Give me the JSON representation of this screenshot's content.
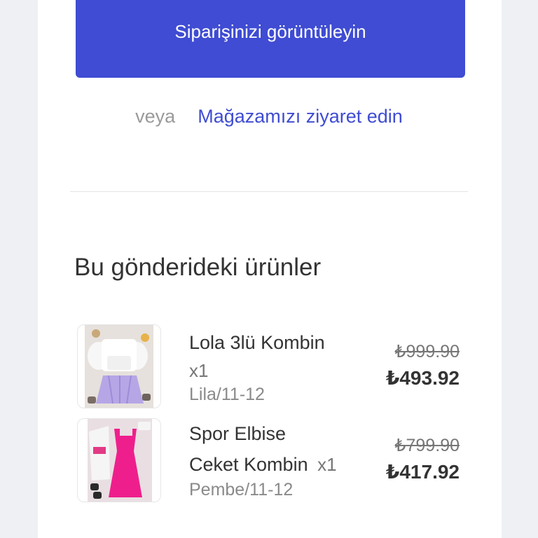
{
  "actions": {
    "view_order_label": "Siparişinizi görüntüleyin",
    "or_label": "veya",
    "visit_store_label": "Mağazamızı ziyaret edin"
  },
  "shipment": {
    "title": "Bu gönderideki ürünler",
    "items": [
      {
        "name": "Lola 3lü Kombin",
        "quantity": "x1",
        "variant": "Lila/11-12",
        "original_price": "₺999.90",
        "price": "₺493.92"
      },
      {
        "name_line1": "Spor Elbise",
        "name_line2": "Ceket Kombin",
        "quantity": "x1",
        "variant": "Pembe/11-12",
        "original_price": "₺799.90",
        "price": "₺417.92"
      }
    ]
  },
  "colors": {
    "accent": "#3f4cd3",
    "text": "#333333",
    "muted": "#8a8a8a"
  }
}
